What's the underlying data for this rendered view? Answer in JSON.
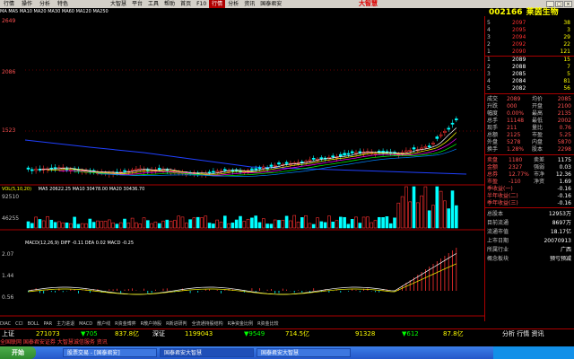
{
  "menu": {
    "items": [
      "行情",
      "操作",
      "分析",
      "特色",
      "大智慧",
      "平台",
      "工具",
      "帮助"
    ],
    "tabs": [
      "首页",
      "F10",
      "行情",
      "分析",
      "资讯",
      "国泰君安"
    ],
    "logo": "大智慧"
  },
  "indicators": {
    "ma_line": "MA MA5 MA10 MA20 MA30 MA60 MA120 MA250",
    "vol_line": "VOL(5,10,20)",
    "vol_ma_values": "MA5 20622.25  MA10 30478.00  MA20 30436.70",
    "macd_line": "MACD(12,26,9)  DIFF -0.11  DEA 0.02  MACD -0.25"
  },
  "price_axis": [
    "2649",
    "2086",
    "1523"
  ],
  "vol_axis": [
    "92510",
    "46255"
  ],
  "macd_axis": [
    "2.07",
    "1.44",
    "0.56"
  ],
  "stock": {
    "code": "002166",
    "name": "莱茵生物"
  },
  "order_book": {
    "sell": [
      {
        "label": "5",
        "price": "2097",
        "vol": "38"
      },
      {
        "label": "4",
        "price": "2095",
        "vol": "3"
      },
      {
        "label": "3",
        "price": "2094",
        "vol": "29"
      },
      {
        "label": "2",
        "price": "2092",
        "vol": "22"
      },
      {
        "label": "1",
        "price": "2090",
        "vol": "121"
      }
    ],
    "buy": [
      {
        "label": "1",
        "price": "2089",
        "vol": "15"
      },
      {
        "label": "2",
        "price": "2088",
        "vol": "7"
      },
      {
        "label": "3",
        "price": "2085",
        "vol": "5"
      },
      {
        "label": "4",
        "price": "2084",
        "vol": "81"
      },
      {
        "label": "5",
        "price": "2082",
        "vol": "56"
      }
    ],
    "side_labels": [
      "委",
      "卖",
      "盘",
      "买",
      "盘"
    ]
  },
  "quote": [
    {
      "l": "成交",
      "v": "2089",
      "l2": "均价",
      "v2": "2085"
    },
    {
      "l": "升跌",
      "v": "000",
      "l2": "开盘",
      "v2": "2100"
    },
    {
      "l": "幅度",
      "v": "0.00%",
      "l2": "最高",
      "v2": "2135"
    },
    {
      "l": "总手",
      "v": "11148",
      "l2": "最低",
      "v2": "2002"
    },
    {
      "l": "现手",
      "v": "211",
      "l2": "量比",
      "v2": "0.76"
    },
    {
      "l": "总额",
      "v": "2125",
      "l2": "市盈",
      "v2": "5.25"
    },
    {
      "l": "外盘",
      "v": "5278",
      "l2": "内盘",
      "v2": "5870"
    },
    {
      "l": "换手",
      "v": "1.28%",
      "l2": "股本",
      "v2": "2298"
    }
  ],
  "fundamentals": [
    {
      "l": "卖盘",
      "v": "1180",
      "l2": "卖差",
      "v2": "1175"
    },
    {
      "l": "金额",
      "v": "2327",
      "l2": "强弱",
      "v2": "0.03"
    },
    {
      "l": "总券",
      "v": "12.77%",
      "l2": "市净",
      "v2": "12.36"
    },
    {
      "l": "市盈",
      "v": "-110",
      "l2": "净资",
      "v2": "1.69"
    },
    {
      "l": "季收益(一)",
      "v": "",
      "l2": "",
      "v2": "-0.16"
    },
    {
      "l": "半年收益(二)",
      "v": "",
      "l2": "",
      "v2": "-0.16"
    },
    {
      "l": "季年收益(三)",
      "v": "",
      "l2": "",
      "v2": "-0.16"
    }
  ],
  "capital": [
    {
      "l": "总股本",
      "v": "12953万"
    },
    {
      "l": "目前流通",
      "v": "8697万"
    },
    {
      "l": "流通市值",
      "v": "18.17亿"
    },
    {
      "l": "上市日期",
      "v": "20070913"
    },
    {
      "l": "所属行业",
      "v": "广西"
    },
    {
      "l": "概念板块",
      "v": "预亏预减"
    }
  ],
  "bottom_tabs": [
    "DIAC",
    "CCI",
    "BOLL",
    "PAR",
    "主力进退",
    "MACD",
    "散户线",
    "R资金博弈",
    "R散户持股",
    "R新进研判",
    "全流通持股结构",
    "R净资金比例",
    "R资金比较"
  ],
  "status": {
    "index1": "上证",
    "v1": "271073",
    "chg1": "▼705",
    "amt1": "837.8亿",
    "index2": "深证",
    "v2": "1199043",
    "chg2": "▼9549",
    "amt2": "714.5亿",
    "v3": "91328",
    "chg3": "▼612",
    "amt3": "87.8亿",
    "right_label": "分析 行情 资讯"
  },
  "ticker": "全国联网 国泰君安证券 大智慧诚信服务 资讯",
  "taskbar": {
    "start": "开始",
    "tasks": [
      "股票交易 - [国泰君安]",
      "国泰君安大智慧",
      "国泰君安大智慧"
    ]
  },
  "colors": {
    "up": "#ff3030",
    "down": "#00ffff",
    "ma5": "#ffffff",
    "ma10": "#ffff00",
    "ma20": "#ff00ff",
    "ma30": "#00ff00",
    "ma60": "#0080ff",
    "accent": "#a00000"
  }
}
